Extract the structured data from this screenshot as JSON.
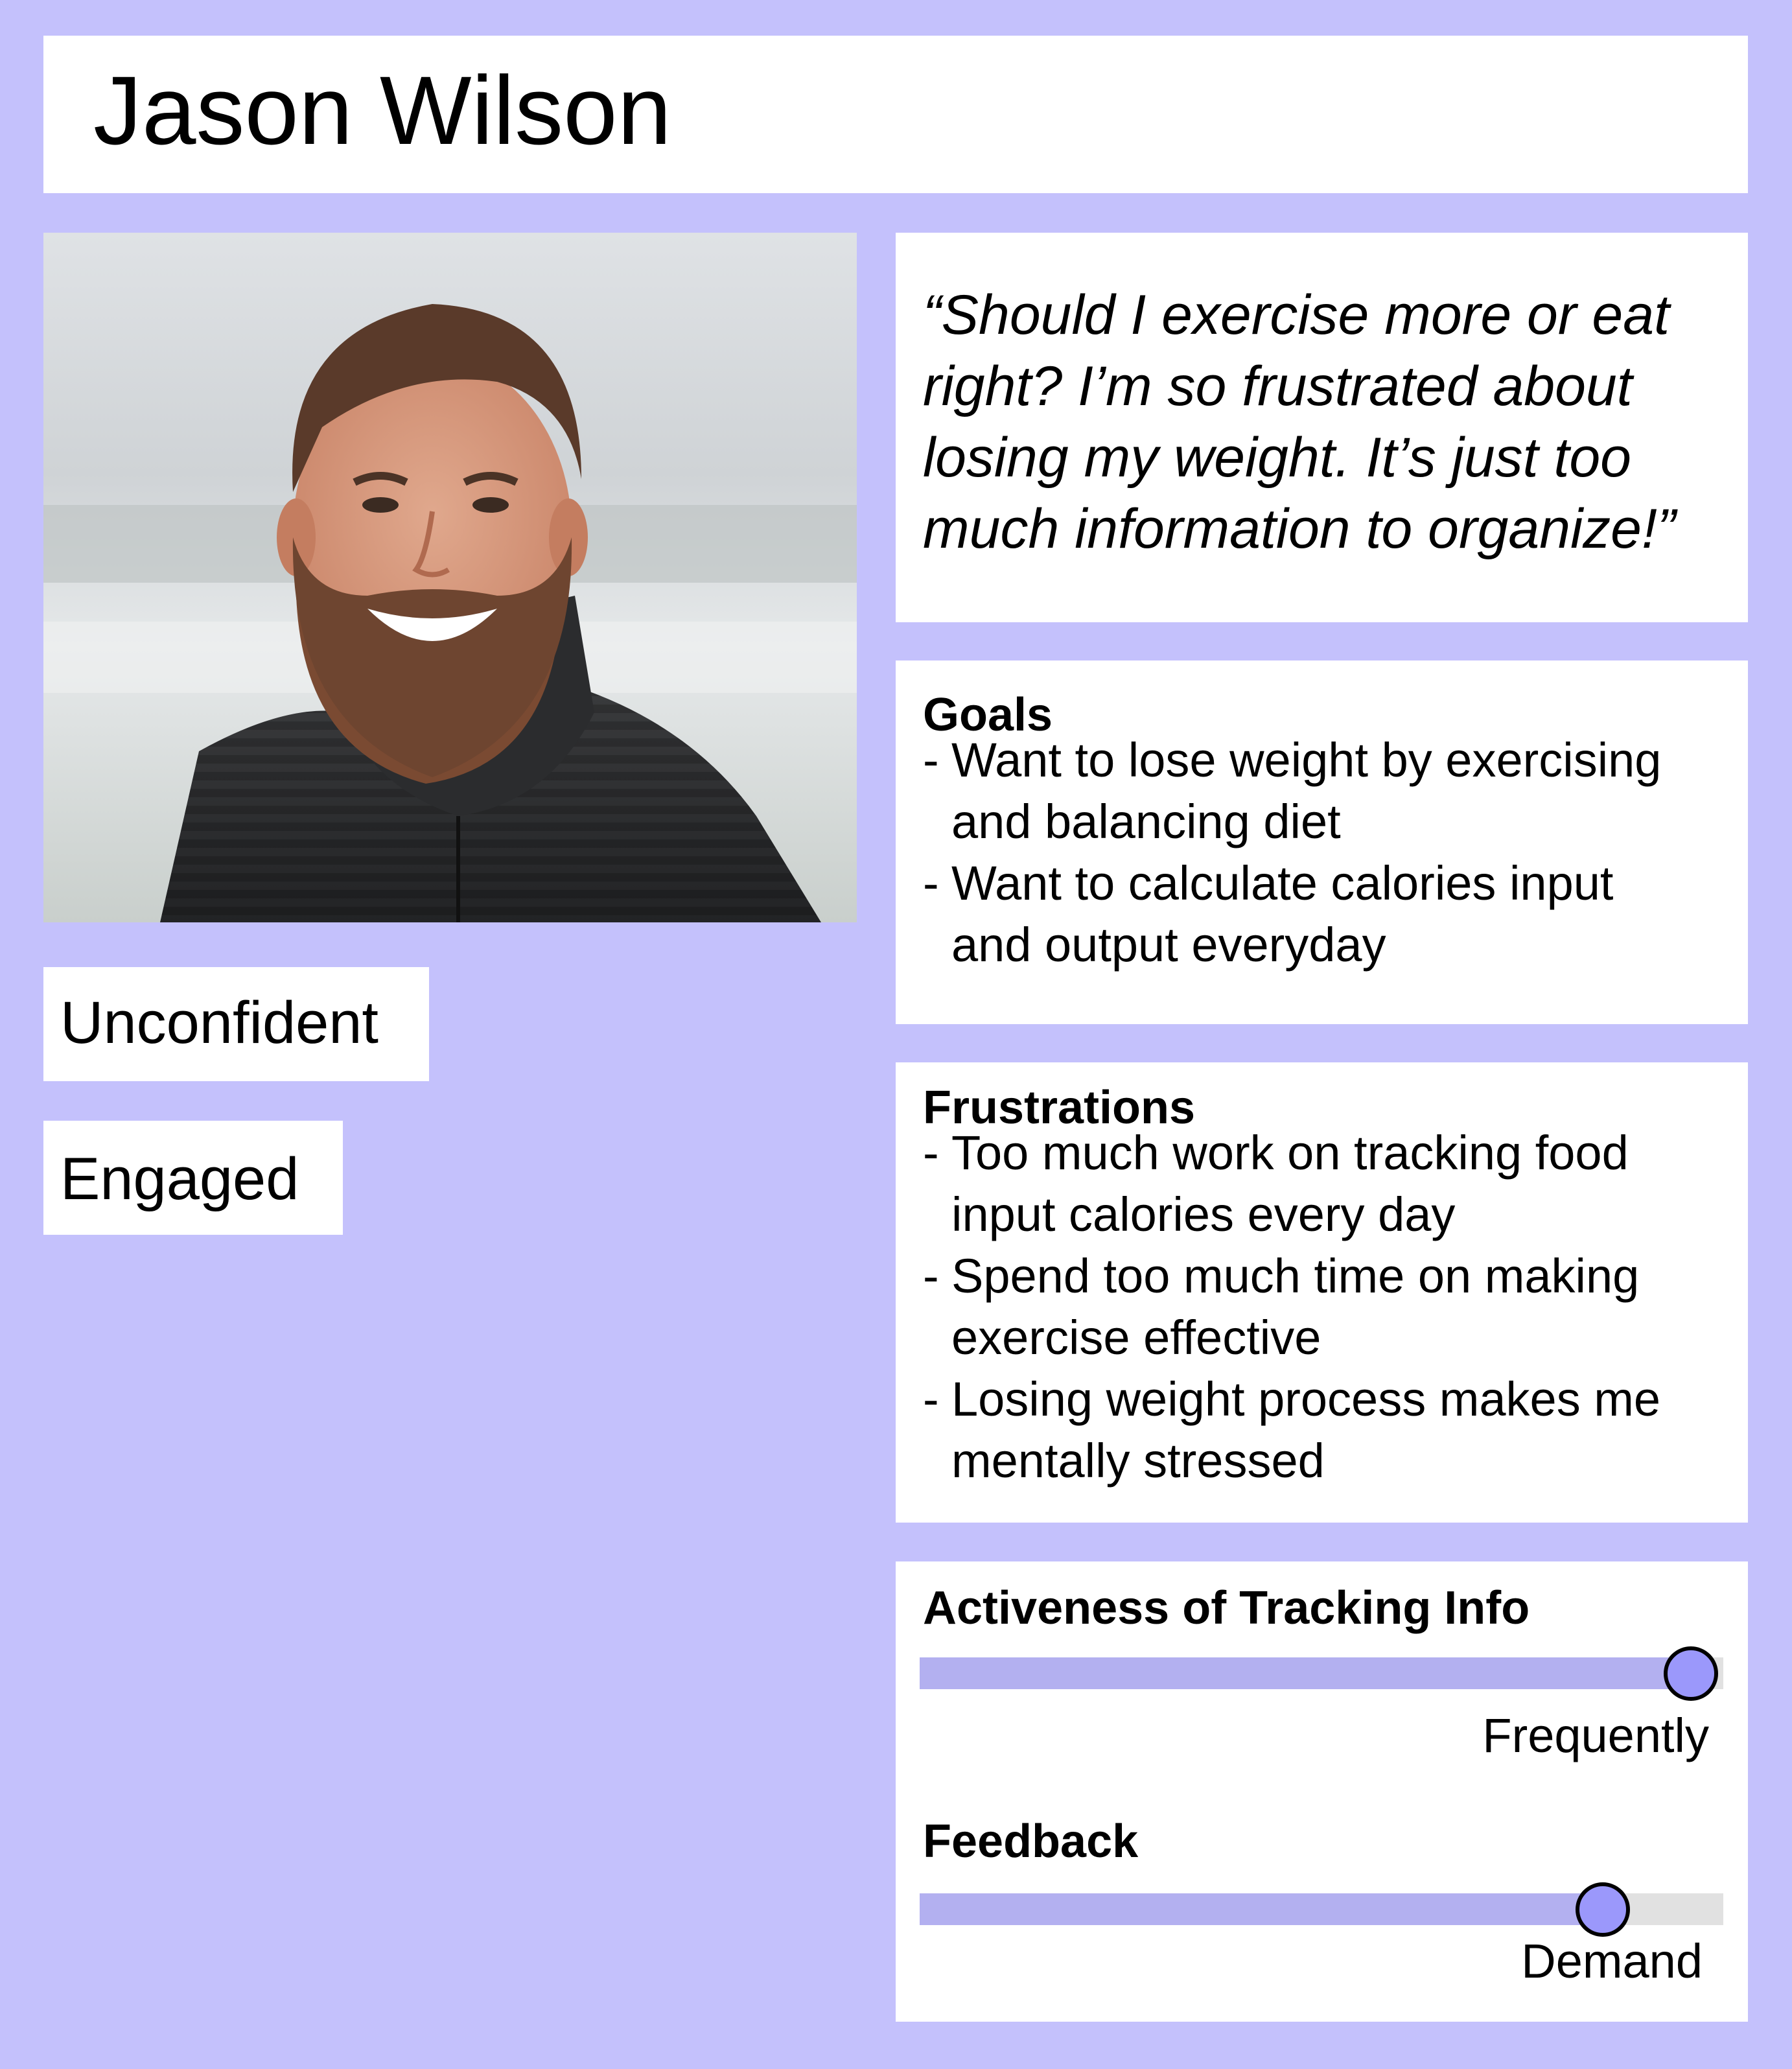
{
  "persona": {
    "name": "Jason Wilson",
    "traits": [
      "Unconfident",
      "Engaged"
    ],
    "quote": "“Should I exercise more or eat right? I’m so frustrated about losing my weight. It’s just too much information to organize!”"
  },
  "goals": {
    "title": "Goals",
    "items": [
      [
        "Want to lose weight by exercising",
        "and balancing diet"
      ],
      [
        "Want to calculate calories input",
        "and output everyday"
      ]
    ]
  },
  "frustrations": {
    "title": "Frustrations",
    "items": [
      [
        "Too much work on tracking food",
        "input calories every day"
      ],
      [
        "Spend too much time on making",
        "exercise effective"
      ],
      [
        "Losing weight process makes me",
        "mentally stressed"
      ]
    ]
  },
  "scales": [
    {
      "title": "Activeness of Tracking Info",
      "label": "Frequently",
      "level_percent": 96
    },
    {
      "title": "Feedback",
      "label": "Demand",
      "level_percent": 85
    }
  ],
  "colors": {
    "background": "#c4c1fc",
    "card": "#ffffff",
    "track_fill": "#b3b0f0",
    "track_empty": "#e1e1e1",
    "knob": "#9b98fb"
  },
  "photo": {
    "icon": "person-portrait-icon"
  }
}
